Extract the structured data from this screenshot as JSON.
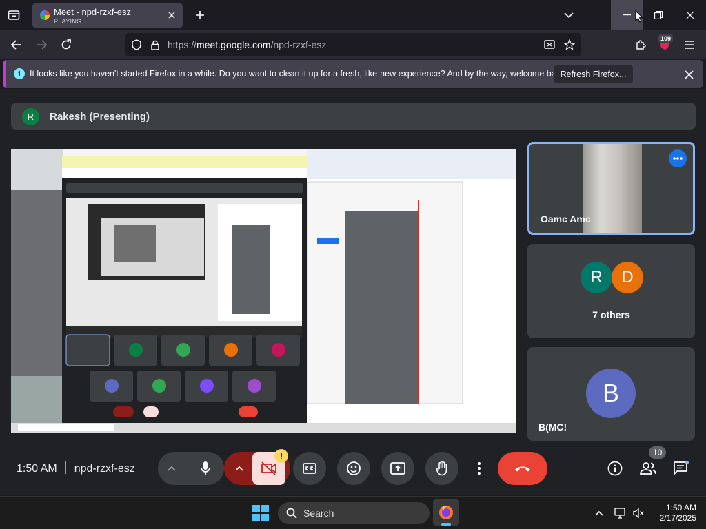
{
  "browser": {
    "tab": {
      "title": "Meet - npd-rzxf-esz",
      "status": "PLAYING"
    },
    "url": {
      "prefix": "https://",
      "host": "meet.google.com",
      "path": "/npd-rzxf-esz"
    },
    "extension_badge": "109"
  },
  "notification": {
    "message": "It looks like you haven't started Firefox in a while. Do you want to clean it up for a fresh, like-new experience? And by the way, welcome back!",
    "button": "Refresh Firefox..."
  },
  "meet": {
    "presenter": {
      "initial": "R",
      "label": "Rakesh (Presenting)"
    },
    "participants": [
      {
        "name": "Oamc Amc",
        "kind": "camera"
      },
      {
        "name": "7 others",
        "initials": [
          "R",
          "D"
        ],
        "colors": [
          "#00796b",
          "#e8710a"
        ]
      },
      {
        "name": "B(MC!",
        "initial": "B",
        "color": "#5c6bc0"
      }
    ],
    "time": "1:50 AM",
    "meeting_code": "npd-rzxf-esz",
    "participant_count": "10",
    "camera_warning": "!"
  },
  "taskbar": {
    "search_label": "Search",
    "time": "1:50 AM",
    "date": "2/17/2025"
  },
  "colors": {
    "meet_bg": "#202124",
    "end_call": "#ea4335",
    "active_tile_border": "#8ab4f8",
    "firefox_accent": "#c53bd0"
  }
}
